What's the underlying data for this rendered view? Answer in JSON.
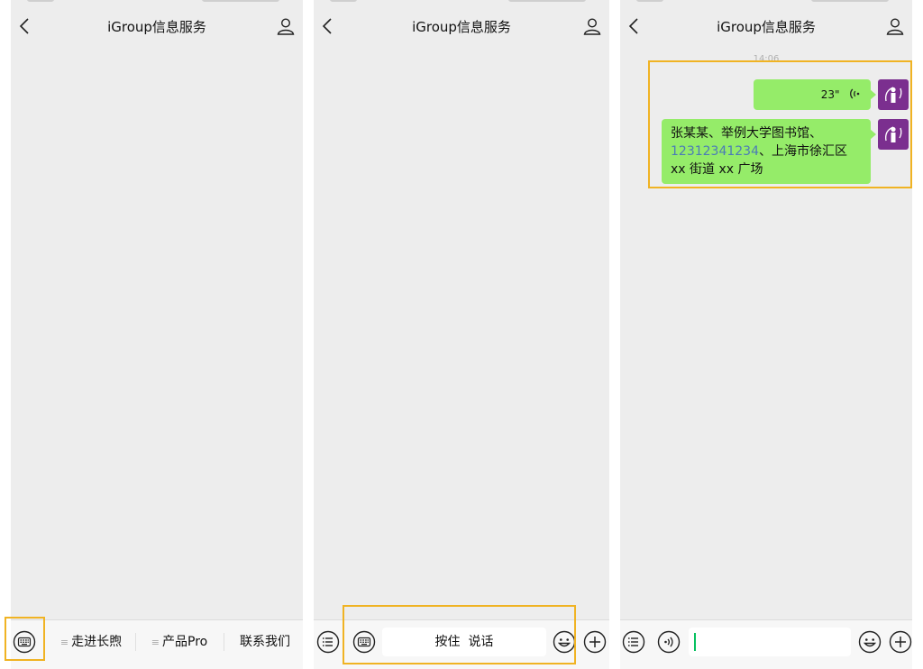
{
  "chat": {
    "title": "iGroup信息服务"
  },
  "panel1": {
    "menu": [
      {
        "label": "走进长煦"
      },
      {
        "label": "产品Pro"
      },
      {
        "label": "联系我们"
      }
    ]
  },
  "panel2": {
    "hold_to_talk": "按住  说话"
  },
  "panel3": {
    "timestamp": "14:06",
    "voice_duration": "23\"",
    "text_message": {
      "part1": "张某某、举例大学图书馆、",
      "phone": "12312341234",
      "part2": "、上海市徐汇区 xx 街道 xx 广场"
    }
  },
  "colors": {
    "panel_bg": "#ededed",
    "bubble_green": "#95ec69",
    "avatar_purple": "#7b2f8f",
    "highlight_orange": "#f0b323",
    "link_blue": "#4b7bb7"
  },
  "icons": {
    "back": "chevron-left-icon",
    "profile": "user-icon",
    "keyboard": "keyboard-icon",
    "menu": "list-icon",
    "voice": "voice-icon",
    "emoji": "emoji-icon",
    "more": "plus-icon"
  }
}
